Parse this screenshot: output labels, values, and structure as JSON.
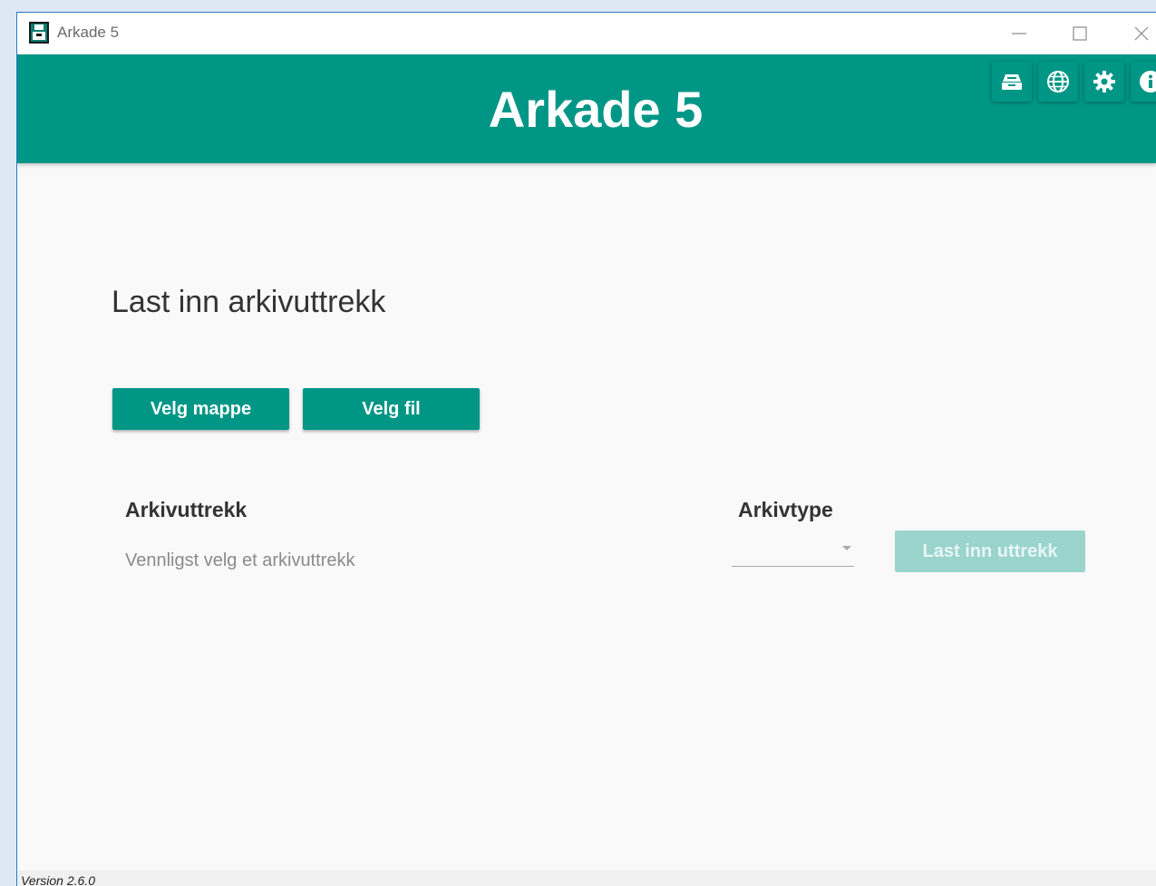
{
  "window": {
    "title": "Arkade 5",
    "icon": "arkade-app-icon",
    "controls": [
      "minimize-icon",
      "maximize-icon",
      "close-icon"
    ]
  },
  "header": {
    "title": "Arkade 5",
    "icons": [
      "archive-tray-icon",
      "globe-icon",
      "gear-icon",
      "info-icon"
    ],
    "color": "#009686"
  },
  "main": {
    "title": "Last inn arkivuttrekk",
    "select_folder_label": "Velg mappe",
    "select_file_label": "Velg fil",
    "archive_extract_label": "Arkivuttrekk",
    "archive_extract_placeholder": "Vennligst velg et arkivuttrekk",
    "archive_type_label": "Arkivtype",
    "archive_type_value": "",
    "load_button_label": "Last inn uttrekk"
  },
  "statusbar": {
    "version": "Version 2.6.0"
  }
}
